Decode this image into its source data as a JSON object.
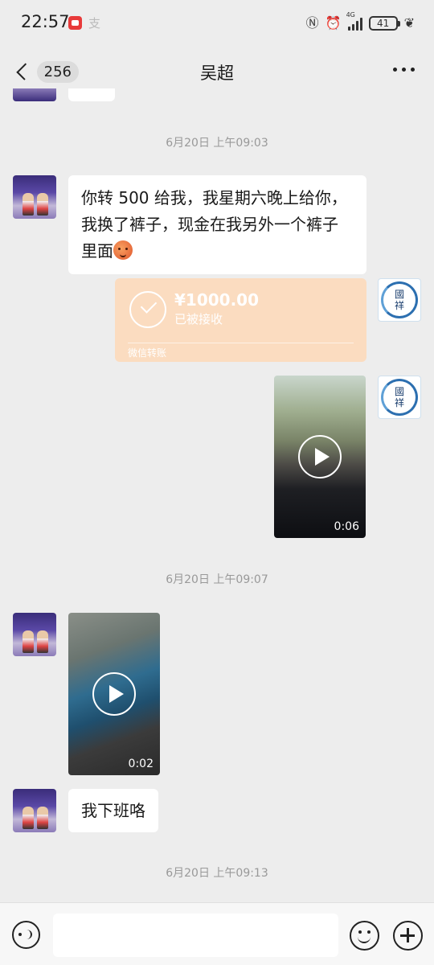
{
  "status_bar": {
    "time": "22:57",
    "network": "4G",
    "battery": "41"
  },
  "header": {
    "unread_count": "256",
    "title": "吴超"
  },
  "messages": [
    {
      "type": "timestamp",
      "text": "6月20日 上午09:03"
    },
    {
      "type": "text",
      "from": "left",
      "text": "你转 500 给我，我星期六晚上给你，我换了裤子，现金在我另外一个裤子里面"
    },
    {
      "type": "transfer",
      "from": "right",
      "amount": "¥1000.00",
      "status": "已被接收",
      "footer": "微信转账"
    },
    {
      "type": "video",
      "from": "right",
      "duration": "0:06"
    },
    {
      "type": "timestamp",
      "text": "6月20日 上午09:07"
    },
    {
      "type": "video",
      "from": "left",
      "duration": "0:02"
    },
    {
      "type": "text",
      "from": "left",
      "text": "我下班咯"
    },
    {
      "type": "timestamp",
      "text": "6月20日 上午09:13"
    }
  ],
  "avatar_right_seal": "國 祥",
  "input_bar": {
    "value": "",
    "placeholder": ""
  },
  "colors": {
    "background": "#ededed",
    "transfer_bubble": "#fbdcc0",
    "bubble": "#ffffff"
  }
}
